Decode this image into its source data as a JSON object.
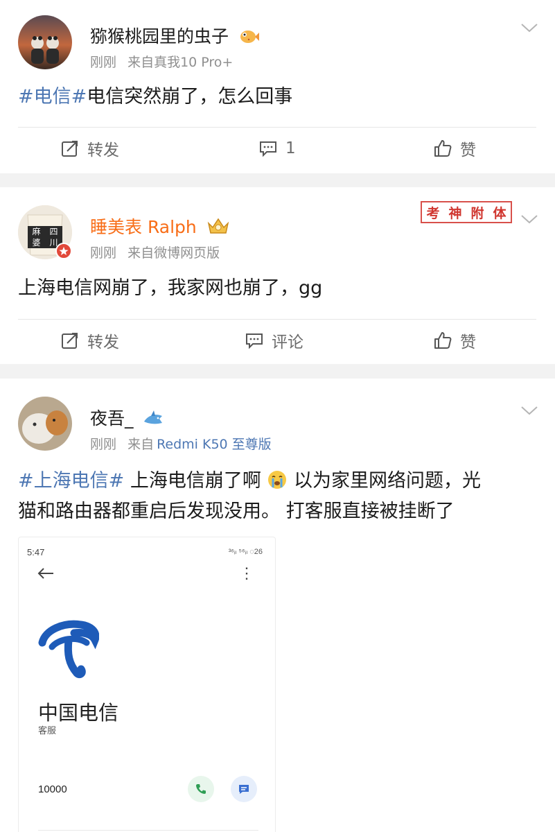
{
  "posts": [
    {
      "username": "猕猴桃园里的虫子",
      "badge_icon": "pufferfish-emoji",
      "time": "刚刚",
      "source": "来自真我10 Pro+",
      "topic": "#电信#",
      "text": "电信突然崩了，怎么回事",
      "actions": {
        "repost": "转发",
        "comment": "1",
        "like": "赞"
      }
    },
    {
      "username": "睡美表 Ralph",
      "username_color": "#f86d17",
      "badge_icon": "crown-member-icon",
      "avatar_text": [
        "麻",
        "四",
        "婆",
        "川"
      ],
      "stamp": [
        "考",
        "神",
        "附",
        "体"
      ],
      "time": "刚刚",
      "source": "来自微博网页版",
      "text": "上海电信网崩了，我家网也崩了，gg",
      "actions": {
        "repost": "转发",
        "comment": "评论",
        "like": "赞"
      }
    },
    {
      "username": "夜吾_",
      "badge_icon": "shark-emoji",
      "time": "刚刚",
      "source_prefix": "来自",
      "source_device": "Redmi K50 至尊版",
      "topic": "#上海电信#",
      "line1_a": "上海电信崩了啊",
      "emoji": "crying-face-emoji",
      "line1_b": "以为家里网络问题，光",
      "line2": "猫和路由器都重启后发现没用。 打客服直接被挂断了",
      "embedded_screenshot": {
        "time": "5:47",
        "status": "³⁶ᵢₗ ⁵⁶ᵢₗ ◌26",
        "company": "中国电信",
        "subtitle": "客服",
        "number": "10000"
      }
    }
  ],
  "colors": {
    "topic": "#4d77b3",
    "meta": "#8f8f8f",
    "highlight_name": "#f86d17",
    "page_bg": "#f2f2f2",
    "telecom_blue": "#1e5bb8"
  }
}
